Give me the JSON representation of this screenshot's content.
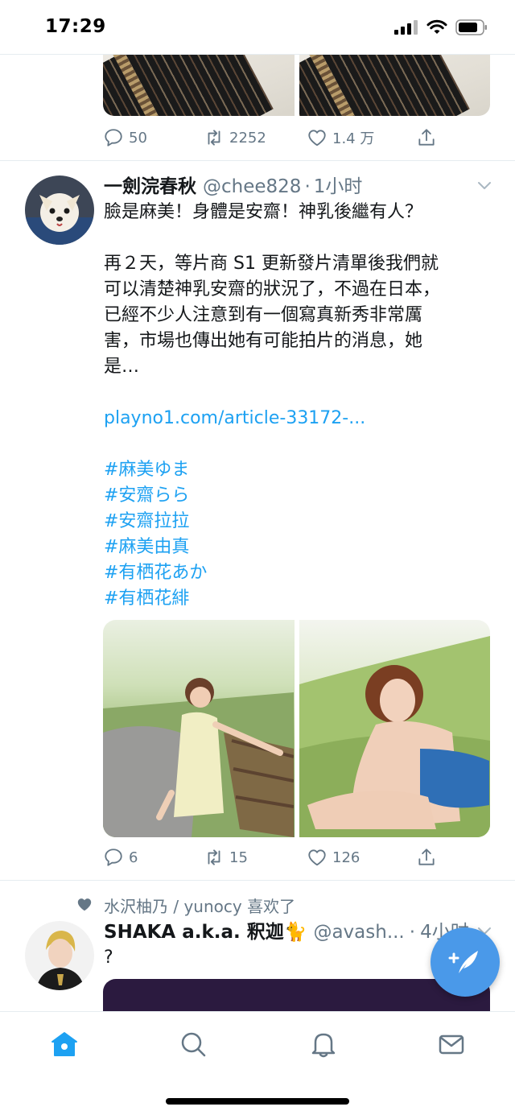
{
  "status_bar": {
    "time": "17:29"
  },
  "prev_tweet": {
    "actions": {
      "replies": "50",
      "retweets": "2252",
      "likes": "1.4 万"
    }
  },
  "tweet1": {
    "display_name": "一劍浣春秋",
    "handle": "@chee828",
    "separator": "·",
    "time": "1小时",
    "lines": [
      "臉是麻美！身體是安齋！神乳後繼有人？",
      "",
      "再２天，等片商 S1 更新發片清單後我們就",
      "可以清楚神乳安齋的狀況了，不過在日本，",
      "已經不少人注意到有一個寫真新秀非常厲",
      "害，市場也傳出她有可能拍片的消息，她",
      "是…"
    ],
    "link": "playno1.com/article-33172-...",
    "hashtags": [
      "#麻美ゆま",
      "#安齋らら",
      "#安齋拉拉",
      "#麻美由真",
      "#有栖花あか",
      "#有栖花緋"
    ],
    "actions": {
      "replies": "6",
      "retweets": "15",
      "likes": "126"
    }
  },
  "tweet2": {
    "liked_by": "水沢柚乃 / yunocy 喜欢了",
    "display_name": "SHAKA a.k.a. 釈迦🐈",
    "handle": "@avash...",
    "separator": "·",
    "time": "4小时",
    "text": "?"
  },
  "colors": {
    "accent": "#1da1f2",
    "muted": "#657786",
    "fab": "#4a99e9"
  },
  "icons": [
    "reply-icon",
    "retweet-icon",
    "like-icon",
    "share-icon",
    "home-icon",
    "search-icon",
    "notifications-icon",
    "messages-icon",
    "compose-icon",
    "chevron-down-icon",
    "heart-filled-icon"
  ]
}
